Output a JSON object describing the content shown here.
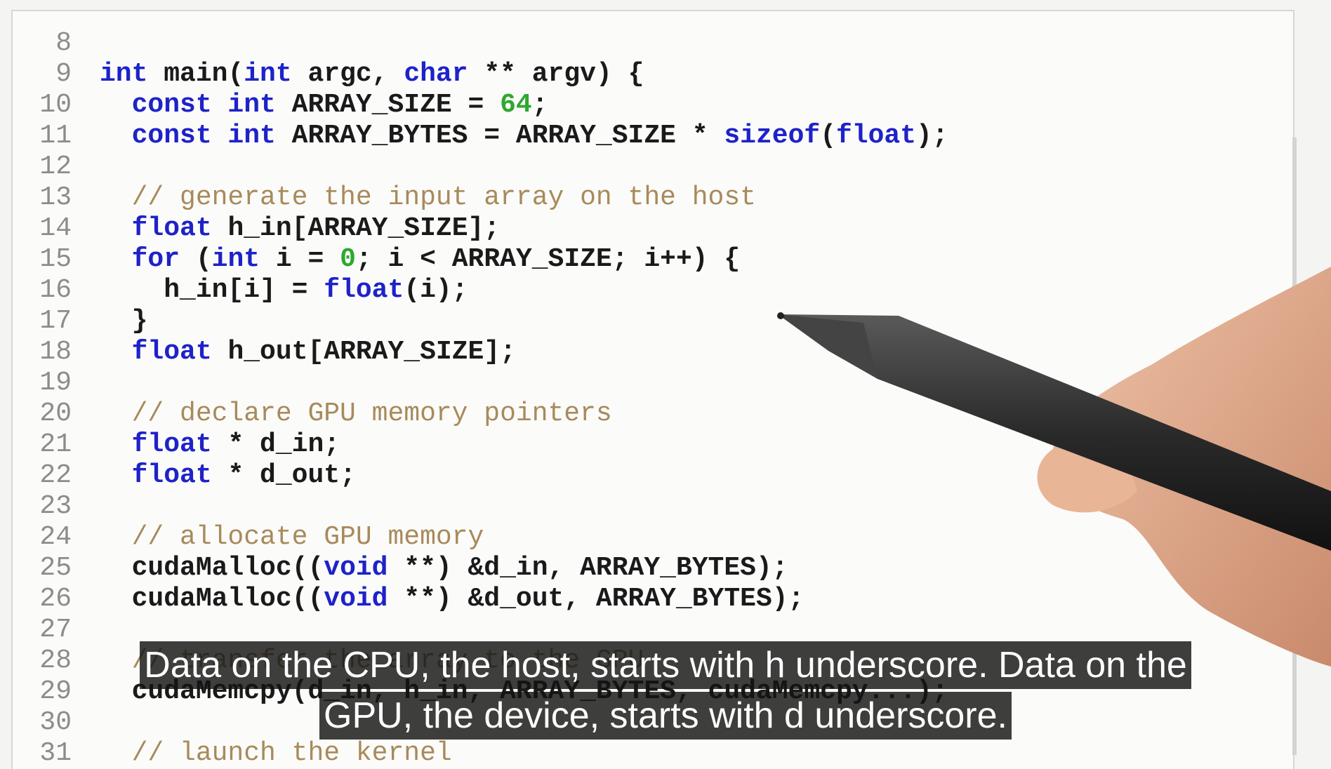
{
  "editor": {
    "lines": [
      {
        "n": "8",
        "tokens": []
      },
      {
        "n": "9",
        "tokens": [
          [
            "kw",
            "int"
          ],
          [
            "plain",
            " main("
          ],
          [
            "kw",
            "int"
          ],
          [
            "plain",
            " argc, "
          ],
          [
            "kw",
            "char"
          ],
          [
            "plain",
            " ** argv) {"
          ]
        ]
      },
      {
        "n": "10",
        "tokens": [
          [
            "plain",
            "  "
          ],
          [
            "kw",
            "const int"
          ],
          [
            "plain",
            " ARRAY_SIZE = "
          ],
          [
            "num",
            "64"
          ],
          [
            "plain",
            ";"
          ]
        ]
      },
      {
        "n": "11",
        "tokens": [
          [
            "plain",
            "  "
          ],
          [
            "kw",
            "const int"
          ],
          [
            "plain",
            " ARRAY_BYTES = ARRAY_SIZE * "
          ],
          [
            "kw",
            "sizeof"
          ],
          [
            "plain",
            "("
          ],
          [
            "kw",
            "float"
          ],
          [
            "plain",
            ");"
          ]
        ]
      },
      {
        "n": "12",
        "tokens": []
      },
      {
        "n": "13",
        "tokens": [
          [
            "plain",
            "  "
          ],
          [
            "cm",
            "// generate the input array on the host"
          ]
        ]
      },
      {
        "n": "14",
        "tokens": [
          [
            "plain",
            "  "
          ],
          [
            "kw",
            "float"
          ],
          [
            "plain",
            " h_in[ARRAY_SIZE];"
          ]
        ]
      },
      {
        "n": "15",
        "tokens": [
          [
            "plain",
            "  "
          ],
          [
            "kw",
            "for"
          ],
          [
            "plain",
            " ("
          ],
          [
            "kw",
            "int"
          ],
          [
            "plain",
            " i = "
          ],
          [
            "num",
            "0"
          ],
          [
            "plain",
            "; i < ARRAY_SIZE; i++) {"
          ]
        ]
      },
      {
        "n": "16",
        "tokens": [
          [
            "plain",
            "    h_in[i] = "
          ],
          [
            "kw",
            "float"
          ],
          [
            "plain",
            "(i);"
          ]
        ]
      },
      {
        "n": "17",
        "tokens": [
          [
            "plain",
            "  }"
          ]
        ]
      },
      {
        "n": "18",
        "tokens": [
          [
            "plain",
            "  "
          ],
          [
            "kw",
            "float"
          ],
          [
            "plain",
            " h_out[ARRAY_SIZE];"
          ]
        ]
      },
      {
        "n": "19",
        "tokens": []
      },
      {
        "n": "20",
        "tokens": [
          [
            "plain",
            "  "
          ],
          [
            "cm",
            "// declare GPU memory pointers"
          ]
        ]
      },
      {
        "n": "21",
        "tokens": [
          [
            "plain",
            "  "
          ],
          [
            "kw",
            "float"
          ],
          [
            "plain",
            " * d_in;"
          ]
        ]
      },
      {
        "n": "22",
        "tokens": [
          [
            "plain",
            "  "
          ],
          [
            "kw",
            "float"
          ],
          [
            "plain",
            " * d_out;"
          ]
        ]
      },
      {
        "n": "23",
        "tokens": []
      },
      {
        "n": "24",
        "tokens": [
          [
            "plain",
            "  "
          ],
          [
            "cm",
            "// allocate GPU memory"
          ]
        ]
      },
      {
        "n": "25",
        "tokens": [
          [
            "plain",
            "  cudaMalloc(("
          ],
          [
            "kw",
            "void"
          ],
          [
            "plain",
            " **) &d_in, ARRAY_BYTES);"
          ]
        ]
      },
      {
        "n": "26",
        "tokens": [
          [
            "plain",
            "  cudaMalloc(("
          ],
          [
            "kw",
            "void"
          ],
          [
            "plain",
            " **) &d_out, ARRAY_BYTES);"
          ]
        ]
      },
      {
        "n": "27",
        "tokens": []
      },
      {
        "n": "28",
        "tokens": [
          [
            "plain",
            "  "
          ],
          [
            "cm",
            "// transfer the array to the GPU"
          ]
        ]
      },
      {
        "n": "29",
        "tokens": [
          [
            "plain",
            "  cudaMemcpy(d_in, h_in, ARRAY_BYTES, cudaMemcpy...);"
          ]
        ]
      },
      {
        "n": "30",
        "tokens": []
      },
      {
        "n": "31",
        "tokens": [
          [
            "plain",
            "  "
          ],
          [
            "cm",
            "// launch the kernel"
          ]
        ]
      }
    ]
  },
  "caption": {
    "line1": "Data on the CPU, the host, starts with h underscore. Data on the",
    "line2": "GPU, the device, starts with d underscore."
  },
  "colors": {
    "keyword": "#1e22c8",
    "comment": "#a88a5a",
    "number": "#2ea82e",
    "text": "#1a1a1a"
  }
}
